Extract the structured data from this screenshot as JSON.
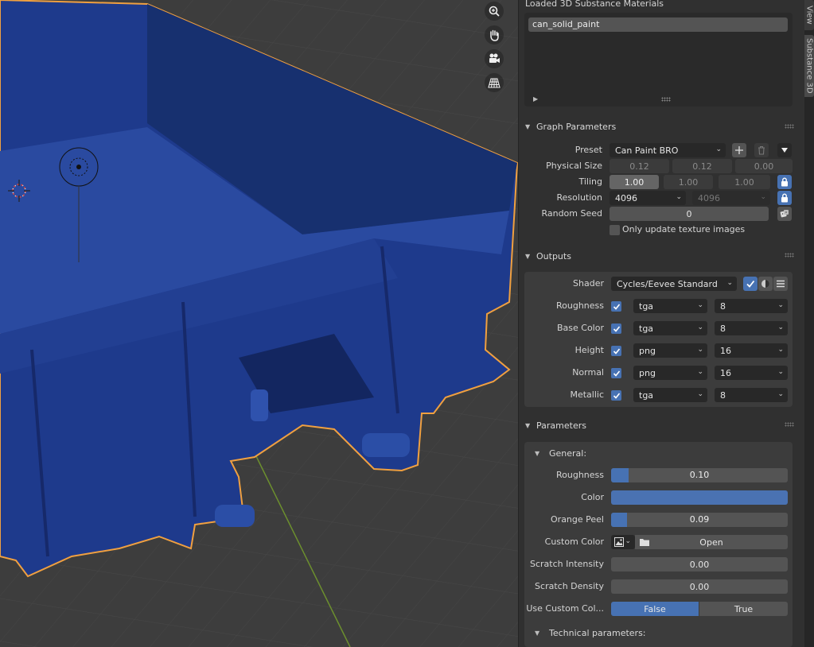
{
  "viewport": {
    "nav_gizmos": [
      "zoom-icon",
      "hand-pan-icon",
      "camera-icon",
      "perspective-grid-icon"
    ],
    "object_color": "#1f3a8a",
    "selection_outline_color": "#f0a040"
  },
  "side_tabs": [
    "View",
    "Substance 3D"
  ],
  "loaded_materials": {
    "title": "Loaded 3D Substance Materials",
    "items": [
      "can_solid_paint"
    ]
  },
  "graph_parameters": {
    "title": "Graph Parameters",
    "preset_label": "Preset",
    "preset_value": "Can Paint BRO",
    "physical_size_label": "Physical Size",
    "physical_size": [
      "0.12",
      "0.12",
      "0.00"
    ],
    "tiling_label": "Tiling",
    "tiling": [
      "1.00",
      "1.00",
      "1.00"
    ],
    "resolution_label": "Resolution",
    "resolution": [
      "4096",
      "4096"
    ],
    "random_seed_label": "Random Seed",
    "random_seed": "0",
    "only_update_label": "Only update texture images"
  },
  "outputs": {
    "title": "Outputs",
    "shader_label": "Shader",
    "shader_value": "Cycles/Eevee Standard",
    "rows": [
      {
        "label": "Roughness",
        "format": "tga",
        "bits": "8"
      },
      {
        "label": "Base Color",
        "format": "tga",
        "bits": "8"
      },
      {
        "label": "Height",
        "format": "png",
        "bits": "16"
      },
      {
        "label": "Normal",
        "format": "png",
        "bits": "16"
      },
      {
        "label": "Metallic",
        "format": "tga",
        "bits": "8"
      }
    ]
  },
  "parameters": {
    "title": "Parameters",
    "general_title": "General:",
    "roughness_label": "Roughness",
    "roughness": "0.10",
    "roughness_fraction": 0.1,
    "color_label": "Color",
    "color_value": "#4a72b2",
    "orange_peel_label": "Orange Peel",
    "orange_peel": "0.09",
    "orange_peel_fraction": 0.09,
    "custom_color_label": "Custom Color",
    "open_label": "Open",
    "scratch_intensity_label": "Scratch Intensity",
    "scratch_intensity": "0.00",
    "scratch_density_label": "Scratch Density",
    "scratch_density": "0.00",
    "use_custom_label": "Use Custom Col...",
    "false_label": "False",
    "true_label": "True",
    "technical_title": "Technical parameters:"
  }
}
